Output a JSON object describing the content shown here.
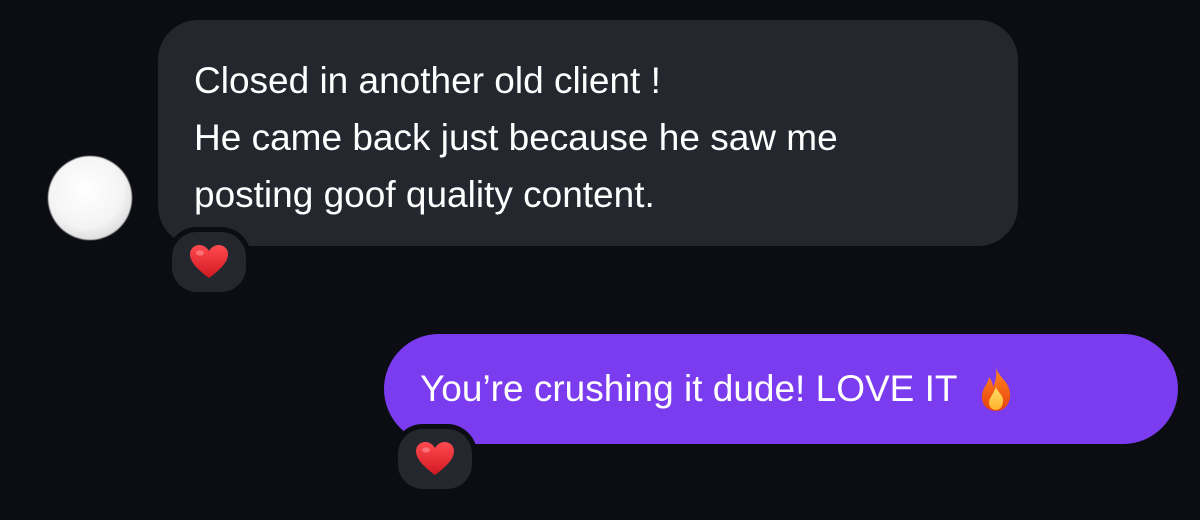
{
  "conversation": {
    "incoming_message": {
      "lines": [
        "Closed in another old client !",
        "He came back just because he saw me",
        "posting goof quality content."
      ],
      "reaction_icon": "red-heart-icon"
    },
    "outgoing_message": {
      "text": "You’re crushing it dude! LOVE IT",
      "trailing_icon": "fire-emoji-icon",
      "reaction_icon": "red-heart-icon"
    }
  },
  "colors": {
    "background": "#0b0d12",
    "incoming_bubble": "#24272e",
    "outgoing_bubble": "#7b3cf0",
    "text": "#ffffff",
    "heart": "#e0242c"
  }
}
